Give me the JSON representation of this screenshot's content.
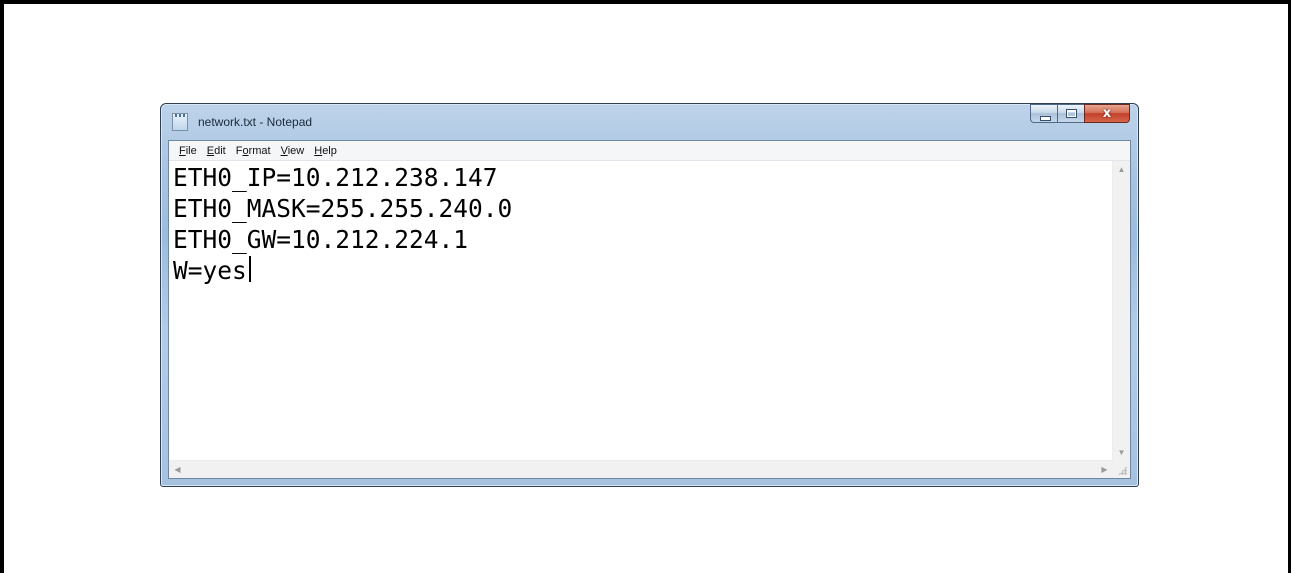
{
  "window": {
    "title": "network.txt - Notepad",
    "app_icon": "notepad-icon",
    "buttons": {
      "minimize_icon": "minimize-icon",
      "maximize_icon": "maximize-icon",
      "close_glyph": "x"
    }
  },
  "menu": [
    {
      "accel": "F",
      "rest": "ile"
    },
    {
      "accel": "E",
      "rest": "dit"
    },
    {
      "pre": "F",
      "accel": "o",
      "rest": "rmat"
    },
    {
      "accel": "V",
      "rest": "iew"
    },
    {
      "accel": "H",
      "rest": "elp"
    }
  ],
  "document": {
    "lines": [
      "ETH0_IP=10.212.238.147",
      "ETH0_MASK=255.255.240.0",
      "ETH0_GW=10.212.224.1",
      "W=yes"
    ]
  },
  "scrollbars": {
    "up_arrow": "▲",
    "down_arrow": "▼",
    "left_arrow": "◀",
    "right_arrow": "▶"
  },
  "colors": {
    "close_button": "#c8452f",
    "title_bar": "#a9c4e0"
  }
}
